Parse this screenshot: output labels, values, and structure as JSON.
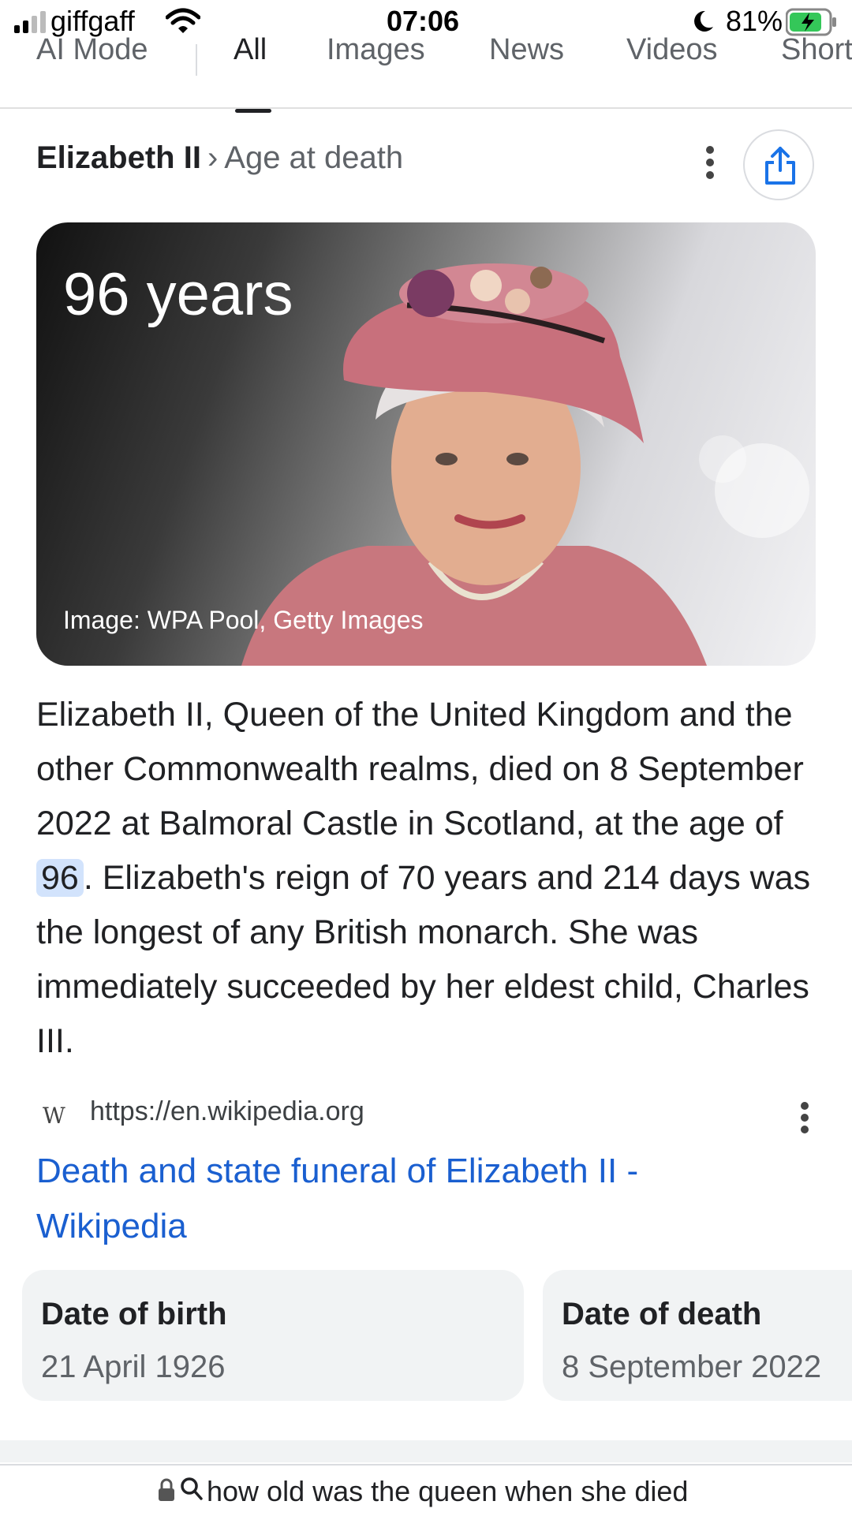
{
  "status_bar": {
    "carrier": "giffgaff",
    "time": "07:06",
    "battery": "81%"
  },
  "tabs": [
    {
      "label": "AI Mode",
      "active": false
    },
    {
      "label": "All",
      "active": true
    },
    {
      "label": "Images",
      "active": false
    },
    {
      "label": "News",
      "active": false
    },
    {
      "label": "Videos",
      "active": false
    },
    {
      "label": "Short",
      "active": false
    }
  ],
  "breadcrumb": {
    "entity": "Elizabeth II",
    "separator": "›",
    "attribute": "Age at death"
  },
  "hero": {
    "title": "96 years",
    "credit": "Image: WPA Pool, Getty Images"
  },
  "description": {
    "before": "Elizabeth II, Queen of the United Kingdom and the other Commonwealth realms, died on 8 September 2022 at Balmoral Castle in Scotland, at the age of ",
    "highlight": "96",
    "after": ". Elizabeth's reign of 70 years and 214 days was the longest of any British monarch. She was immediately succeeded by her eldest child, Charles III."
  },
  "source": {
    "icon": "W",
    "url": "https://en.wikipedia.org",
    "title": "Death and state funeral of Elizabeth II - Wikipedia"
  },
  "facts": [
    {
      "label": "Date of birth",
      "value": "21 April 1926"
    },
    {
      "label": "Date of death",
      "value": "8 September 2022"
    }
  ],
  "url_bar": {
    "query": "how old was the queen when she died"
  },
  "colors": {
    "link": "#1a5fd0",
    "highlight": "#d2e3fc",
    "card_bg": "#f1f3f4",
    "share_icon": "#1a73e8",
    "battery_green": "#34c759"
  }
}
